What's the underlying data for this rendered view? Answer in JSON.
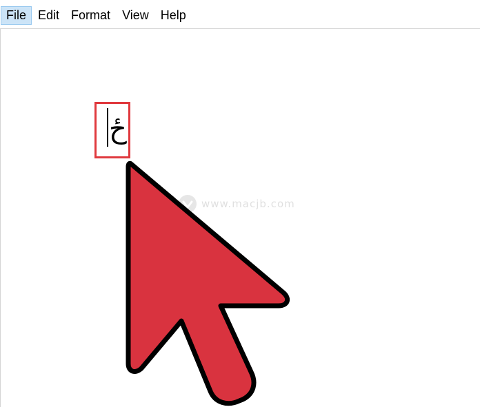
{
  "menubar": {
    "items": [
      {
        "label": "File",
        "active": true
      },
      {
        "label": "Edit",
        "active": false
      },
      {
        "label": "Format",
        "active": false
      },
      {
        "label": "View",
        "active": false
      },
      {
        "label": "Help",
        "active": false
      }
    ]
  },
  "editor": {
    "text": "ځ",
    "highlight_color": "#e0393e"
  },
  "overlay": {
    "cursor_icon": "mouse-pointer-arrow-icon",
    "cursor_color": "#d9333f",
    "watermark_text": "www.macjb.com"
  }
}
